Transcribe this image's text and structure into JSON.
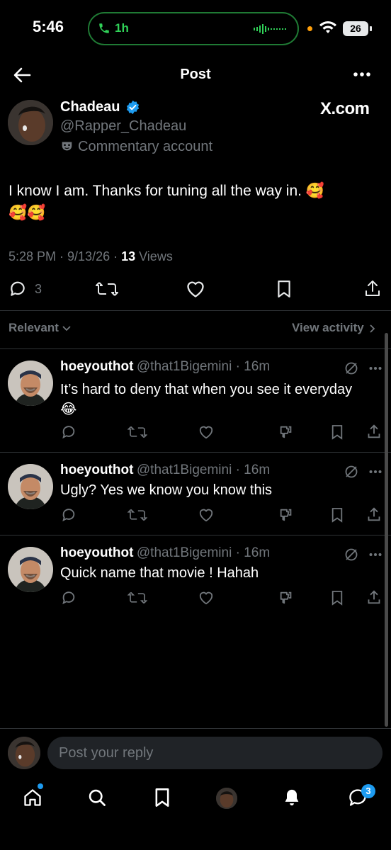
{
  "status_bar": {
    "time": "5:46",
    "call_timer": "1h",
    "battery": "26"
  },
  "header": {
    "title": "Post"
  },
  "post": {
    "author_name": "Chadeau",
    "handle": "@Rapper_Chadeau",
    "label": "Commentary account",
    "source": "X.com",
    "text_line1": "I know I am. Thanks for tuning all the way in. 🥰",
    "text_line2": "🥰🥰",
    "time": "5:28 PM · 9/13/26 · ",
    "views_count": "13",
    "views_label": " Views",
    "reply_count": "3"
  },
  "filters": {
    "relevant": "Relevant",
    "view_activity": "View activity"
  },
  "replies": [
    {
      "name": "hoeyouthot",
      "handle": "@that1Bigemini · 16m",
      "text": "It’s hard to deny that when you see it everyday",
      "emoji": "😂"
    },
    {
      "name": "hoeyouthot",
      "handle": "@that1Bigemini · 16m",
      "text": "Ugly? Yes we know you know this"
    },
    {
      "name": "hoeyouthot",
      "handle": "@that1Bigemini · 16m",
      "text": "Quick name that movie ! Hahah"
    }
  ],
  "composer": {
    "placeholder": "Post your reply"
  },
  "bottom_nav": {
    "messages_badge": "3"
  },
  "colors": {
    "background": "#000000",
    "accent": "#1d9bf0",
    "muted": "#71767b",
    "call_green": "#30d158"
  }
}
